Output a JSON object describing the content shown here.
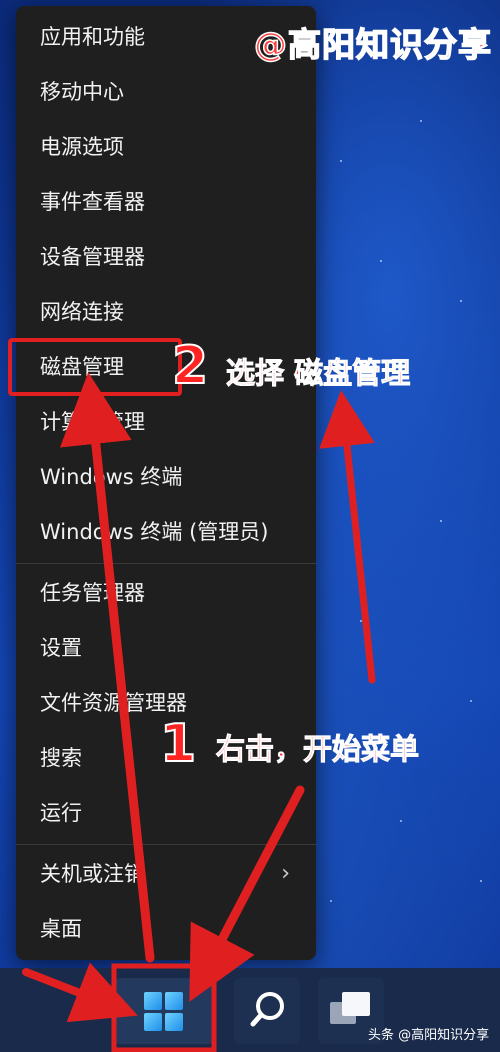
{
  "menu": {
    "items": [
      {
        "label": "应用和功能"
      },
      {
        "label": "移动中心"
      },
      {
        "label": "电源选项"
      },
      {
        "label": "事件查看器"
      },
      {
        "label": "设备管理器"
      },
      {
        "label": "网络连接"
      },
      {
        "label": "磁盘管理"
      },
      {
        "label": "计算机管理"
      },
      {
        "label": "Windows 终端"
      },
      {
        "label": "Windows 终端 (管理员)"
      },
      {
        "label": "任务管理器"
      },
      {
        "label": "设置"
      },
      {
        "label": "文件资源管理器"
      },
      {
        "label": "搜索"
      },
      {
        "label": "运行"
      },
      {
        "label": "关机或注销",
        "arrow": "›"
      },
      {
        "label": "桌面"
      }
    ]
  },
  "annotations": {
    "watermark": "@高阳知识分享",
    "step2_number": "2",
    "step2_text": "选择 磁盘管理",
    "step1_number": "1",
    "step1_text": "右击，开始菜单"
  },
  "footer": "头条 @高阳知识分享",
  "colors": {
    "menu_bg": "#1f1f1f",
    "accent_red": "#e02020",
    "desktop_blue": "#1446b4"
  },
  "icons": [
    "windows-start-icon",
    "search-icon",
    "task-view-icon",
    "chevron-right-icon"
  ]
}
